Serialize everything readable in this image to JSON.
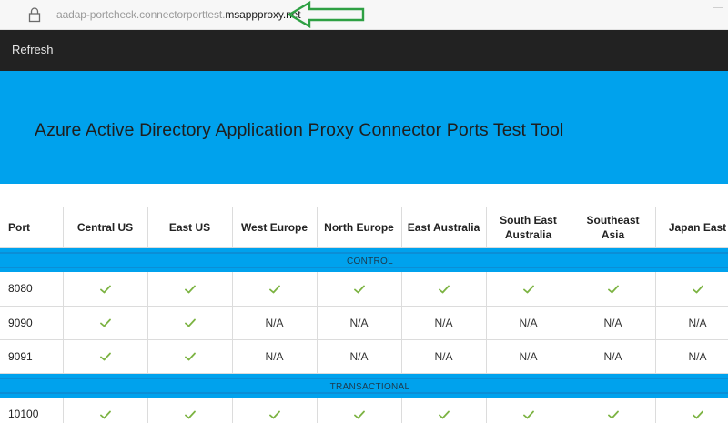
{
  "browser": {
    "url_dim": "aadap-portcheck.connectorporttest.",
    "url_strong": "msappproxy.net",
    "lock_icon": "lock-icon",
    "annotation_arrow_color": "#2ea043"
  },
  "nav": {
    "refresh_label": "Refresh"
  },
  "hero": {
    "title": "Azure Active Directory Application Proxy Connector Ports Test Tool"
  },
  "colors": {
    "accent": "#00a2ed",
    "nav_bg": "#222222",
    "check": "#7cb342"
  },
  "table": {
    "headers": [
      "Port",
      "Central US",
      "East US",
      "West Europe",
      "North Europe",
      "East Australia",
      "South East Australia",
      "Southeast Asia",
      "Japan East"
    ],
    "sections": [
      {
        "label": "CONTROL",
        "rows": [
          {
            "port": "8080",
            "cells": [
              "check",
              "check",
              "check",
              "check",
              "check",
              "check",
              "check",
              "check"
            ]
          },
          {
            "port": "9090",
            "cells": [
              "check",
              "check",
              "N/A",
              "N/A",
              "N/A",
              "N/A",
              "N/A",
              "N/A"
            ]
          },
          {
            "port": "9091",
            "cells": [
              "check",
              "check",
              "N/A",
              "N/A",
              "N/A",
              "N/A",
              "N/A",
              "N/A"
            ]
          }
        ]
      },
      {
        "label": "TRANSACTIONAL",
        "rows": [
          {
            "port": "10100",
            "cells": [
              "check",
              "check",
              "check",
              "check",
              "check",
              "check",
              "check",
              "check"
            ]
          }
        ]
      }
    ]
  }
}
